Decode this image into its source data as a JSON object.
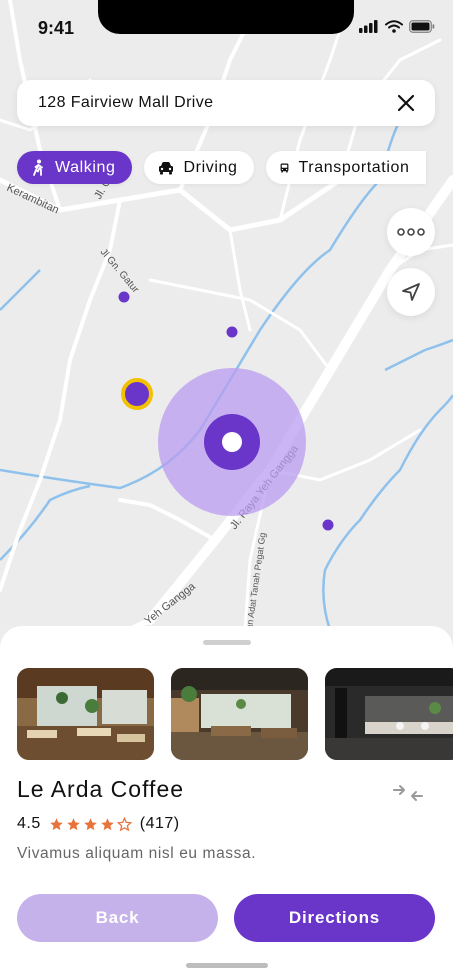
{
  "status_bar": {
    "time": "9:41"
  },
  "search": {
    "value": "128 Fairview Mall Drive"
  },
  "modes": [
    {
      "label": "Walking",
      "icon": "walking-icon",
      "active": true
    },
    {
      "label": "Driving",
      "icon": "car-icon",
      "active": false
    },
    {
      "label": "Transportation",
      "icon": "bus-icon",
      "active": false
    }
  ],
  "map_labels": {
    "kerambitan": "Kerambitan",
    "jl_gn": "Jl. Gn",
    "jl_gn_gatur": "Jl Gn. Gatur",
    "raya_yeh_gangga": "Jl. Raya Yeh Gangga",
    "yeh_gangga": "Yeh Gangga",
    "adat_tanah_pegat": "an Adat Tanah Pegat Gg"
  },
  "place": {
    "name": "Le Arda Coffee",
    "rating": "4.5",
    "rating_value": 4.5,
    "reviews": "(417)",
    "description": "Vivamus aliquam nisl eu massa."
  },
  "actions": {
    "back": "Back",
    "directions": "Directions"
  },
  "colors": {
    "accent": "#6a35c9",
    "accent_light": "#c6b2ea",
    "star": "#e8733a",
    "map_bg": "#ececec",
    "water": "#8ec1ec",
    "marker_yellow": "#f2c200"
  }
}
